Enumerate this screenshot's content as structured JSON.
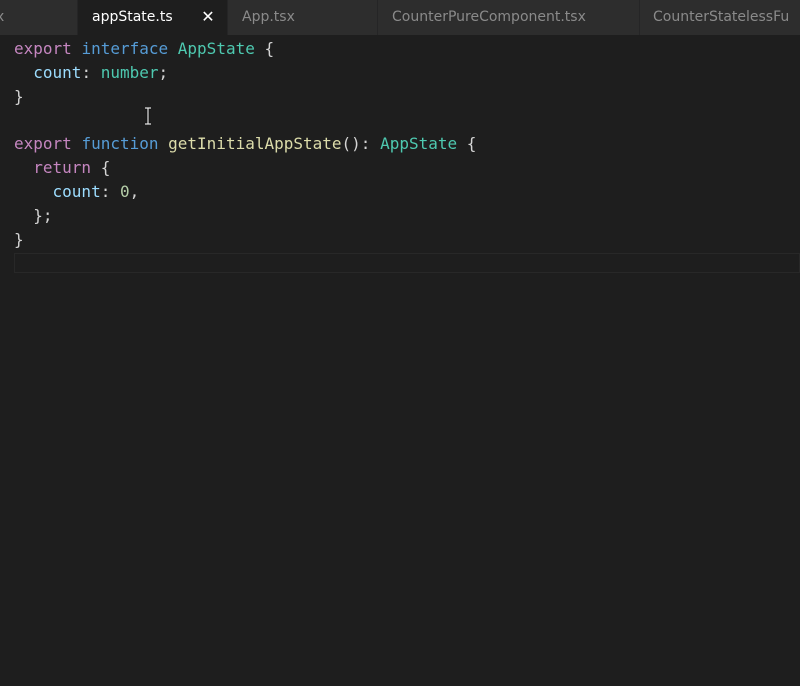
{
  "tabs": [
    {
      "label": "x",
      "active": false
    },
    {
      "label": "appState.ts",
      "active": true,
      "close_glyph": "✕"
    },
    {
      "label": "App.tsx",
      "active": false
    },
    {
      "label": "CounterPureComponent.tsx",
      "active": false
    },
    {
      "label": "CounterStatelessFu",
      "active": false
    }
  ],
  "code": {
    "line1": {
      "t1": "export",
      "t2": "interface",
      "t3": "AppState",
      "t4": "{"
    },
    "line2": {
      "t1": "count",
      "t2": ":",
      "t3": "number",
      "t4": ";"
    },
    "line3": {
      "t1": "}"
    },
    "line5": {
      "t1": "export",
      "t2": "function",
      "t3": "getInitialAppState",
      "t4": "():",
      "t5": "AppState",
      "t6": "{"
    },
    "line6": {
      "t1": "return",
      "t2": "{"
    },
    "line7": {
      "t1": "count",
      "t2": ":",
      "t3": "0",
      "t4": ","
    },
    "line8": {
      "t1": "};"
    },
    "line9": {
      "t1": "}"
    }
  },
  "colors": {
    "keyword_control": "#c586c0",
    "keyword_storage": "#569cd6",
    "type": "#4ec9b0",
    "property": "#9cdcfe",
    "function": "#dcdcaa",
    "number": "#b5cea8",
    "background": "#1e1e1e"
  },
  "icons": {
    "text_cursor": "i-beam-cursor-icon",
    "tab_close": "close-icon"
  }
}
